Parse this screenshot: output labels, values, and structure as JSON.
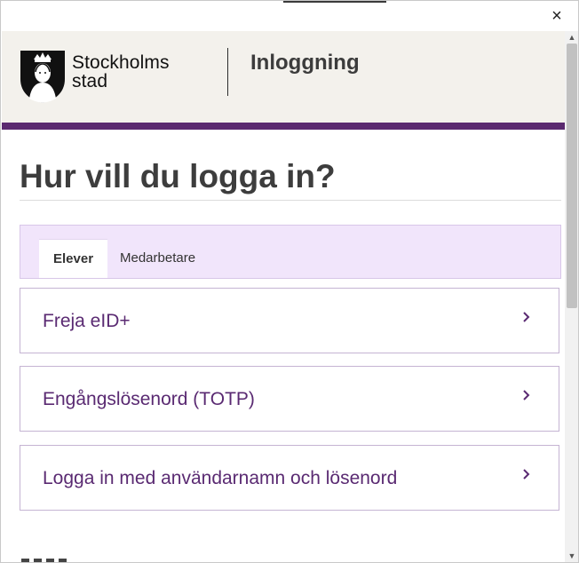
{
  "window": {
    "close_symbol": "×"
  },
  "header": {
    "logo_line1": "Stockholms",
    "logo_line2": "stad",
    "app_title": "Inloggning"
  },
  "page": {
    "title": "Hur vill du logga in?"
  },
  "tabs": [
    {
      "label": "Elever",
      "active": true
    },
    {
      "label": "Medarbetare",
      "active": false
    }
  ],
  "login_options": [
    {
      "label": "Freja eID+"
    },
    {
      "label": "Engångslösenord (TOTP)"
    },
    {
      "label": "Logga in med användarnamn och lösenord"
    }
  ],
  "colors": {
    "brand_purple": "#5b2a70",
    "option_text": "#5a2a72",
    "tab_bar_bg": "#f1e5fb",
    "header_bg": "#f3f1ec"
  },
  "icons": [
    "close-icon",
    "stockholm-shield-logo",
    "chevron-right-icon"
  ]
}
